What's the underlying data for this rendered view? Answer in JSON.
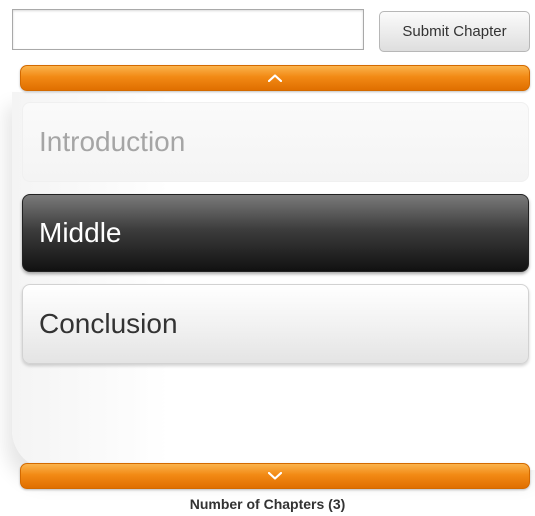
{
  "form": {
    "chapter_input_value": "",
    "submit_label": "Submit Chapter"
  },
  "scroller": {
    "up_icon": "chevron-up-icon",
    "down_icon": "chevron-down-icon",
    "accent_color": "#f28a15"
  },
  "chapters": [
    {
      "label": "Introduction",
      "state": "faded"
    },
    {
      "label": "Middle",
      "state": "selected"
    },
    {
      "label": "Conclusion",
      "state": "normal"
    }
  ],
  "footer": {
    "count_text": "Number of Chapters (3)"
  }
}
